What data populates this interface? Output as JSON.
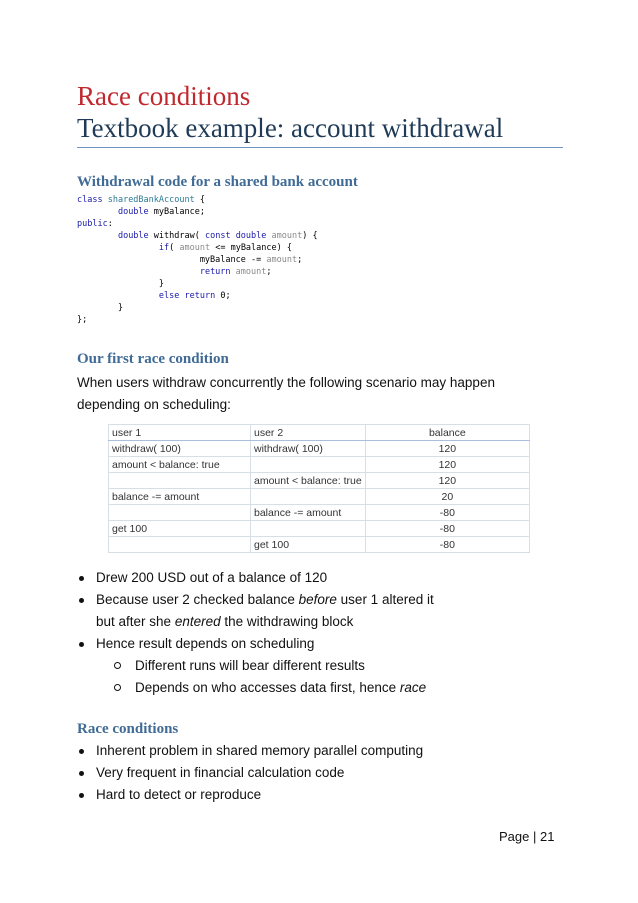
{
  "title": {
    "line1": "Race conditions",
    "line2": "Textbook example: account withdrawal",
    "line1_color": "#c0282e",
    "line2_color": "#1f3b57",
    "rule_color": "#6b93c4"
  },
  "section1": {
    "heading": "Withdrawal code for a shared bank account",
    "code_lines": [
      "class sharedBankAccount {",
      "        double myBalance;",
      "public:",
      "        double withdraw( const double amount) {",
      "                if( amount <= myBalance) {",
      "                        myBalance -= amount;",
      "                        return amount;",
      "                }",
      "                else return 0;",
      "        }",
      "};"
    ]
  },
  "section2": {
    "heading": "Our first race condition",
    "para_line1": "When users withdraw concurrently the following scenario may happen",
    "para_line2": "depending on scheduling:",
    "table": {
      "headers": [
        "user 1",
        "user 2",
        "balance"
      ],
      "rows": [
        [
          "withdraw( 100)",
          "withdraw( 100)",
          "120"
        ],
        [
          "amount < balance: true",
          "",
          "120"
        ],
        [
          "",
          "amount < balance: true",
          "120"
        ],
        [
          "balance -= amount",
          "",
          "20"
        ],
        [
          "",
          "balance -= amount",
          "-80"
        ],
        [
          "get 100",
          "",
          "-80"
        ],
        [
          "",
          "get 100",
          "-80"
        ]
      ]
    },
    "bullets": {
      "b1": "Drew 200 USD out of a balance of 120",
      "b2_before": "Because user 2 checked balance ",
      "b2_em": "before",
      "b2_after": " user 1 altered it",
      "b2c_before": "but after she ",
      "b2c_em": "entered",
      "b2c_after": " the withdrawing block",
      "b3": "Hence result depends on scheduling",
      "s1": "Different runs will bear different results",
      "s2_before": "Depends on who accesses data first, hence ",
      "s2_em": "race"
    }
  },
  "section3": {
    "heading": "Race conditions",
    "bullets": [
      "Inherent problem in shared memory parallel computing",
      "Very frequent in financial calculation code",
      "Hard to detect or reproduce"
    ]
  },
  "footer": {
    "page_label": "Page | 21"
  },
  "colors": {
    "heading": "#3f6b96",
    "keyword": "#1a1aa8",
    "type": "#2b7c95",
    "param": "#8a8a8a"
  }
}
